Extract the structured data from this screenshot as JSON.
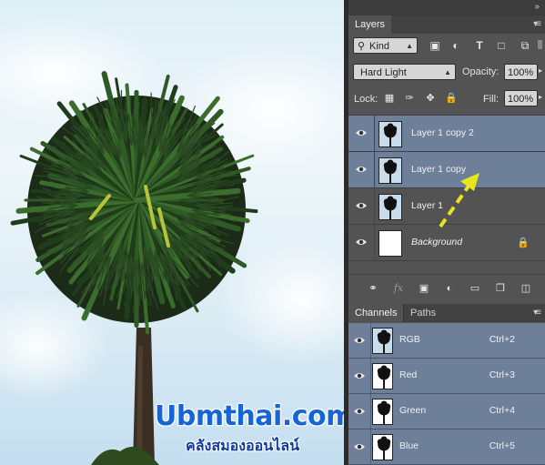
{
  "watermark": {
    "logo_text": "Ubmthai.com",
    "tagline": "คลังสมองออนไลน์"
  },
  "layers_panel": {
    "tab_label": "Layers",
    "filter_kind": "Kind",
    "blend_mode": "Hard Light",
    "opacity_label": "Opacity:",
    "opacity_value": "100%",
    "lock_label": "Lock:",
    "fill_label": "Fill:",
    "fill_value": "100%",
    "layers": [
      {
        "name": "Layer 1 copy 2",
        "selected": true,
        "visible": true,
        "thumb": "palm"
      },
      {
        "name": "Layer 1 copy",
        "selected": true,
        "visible": true,
        "thumb": "palm"
      },
      {
        "name": "Layer 1",
        "selected": false,
        "visible": true,
        "thumb": "palm"
      },
      {
        "name": "Background",
        "selected": false,
        "visible": true,
        "thumb": "white",
        "locked": true
      }
    ],
    "footer_icons": [
      "link-icon",
      "fx-icon",
      "mask-icon",
      "adjustment-icon",
      "folder-icon",
      "new-layer-icon",
      "trash-icon"
    ]
  },
  "channels_panel": {
    "tabs": [
      {
        "label": "Channels",
        "active": true
      },
      {
        "label": "Paths",
        "active": false
      }
    ],
    "channels": [
      {
        "name": "RGB",
        "shortcut": "Ctrl+2"
      },
      {
        "name": "Red",
        "shortcut": "Ctrl+3"
      },
      {
        "name": "Green",
        "shortcut": "Ctrl+4"
      },
      {
        "name": "Blue",
        "shortcut": "Ctrl+5"
      }
    ]
  },
  "colors": {
    "panel_bg": "#535353",
    "selected_row": "#6e7f99",
    "annotation_arrow": "#e6e61e",
    "watermark_blue": "#1565d8"
  }
}
